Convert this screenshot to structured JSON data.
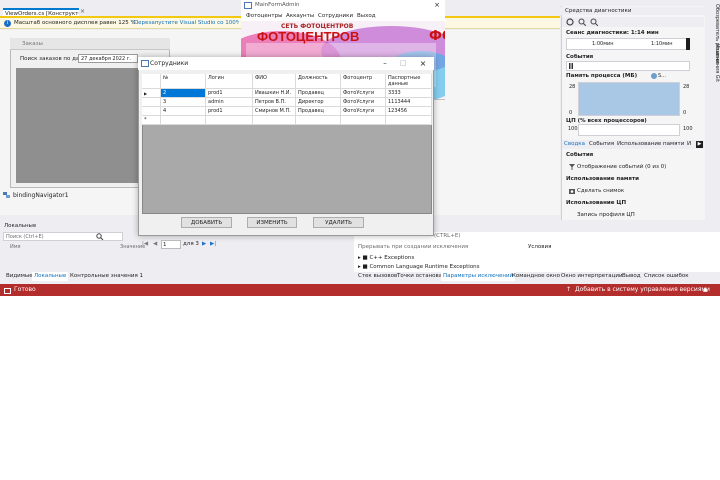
{
  "doc_tab": {
    "label": "ViewOrders.cs [Конструктор]",
    "close": "×"
  },
  "infobar": {
    "icon": "i",
    "text": "Масштаб основного дисплея равен 125 %.",
    "link": "Перезапустите Visual Studio со 100%-ным"
  },
  "designer": {
    "form_title": "Заказы",
    "search_label": "Поиск заказов по дате:",
    "date_value": "27 декабря 2022 г.",
    "binding_navigator": "bindingNavigator1"
  },
  "locals": {
    "header": "Локальные",
    "search_placeholder": "Поиск (Ctrl+E)",
    "col_name": "Имя",
    "col_value": "Значение"
  },
  "bottom_tabs_left": [
    "Видимые",
    "Локальные",
    "Контрольные значения 1"
  ],
  "exceptions": {
    "search_hint": "(CTRL+E)",
    "col_exceptions": "Прерывать при создании исключения",
    "col_conditions": "Условия",
    "rows": [
      "C++ Exceptions",
      "Common Language Runtime Exceptions"
    ]
  },
  "bottom_tabs_right": [
    "Стек вызовов",
    "Точки останова",
    "Параметры исключений",
    "Командное окно",
    "Окно интерпретации",
    "Вывод",
    "Список ошибок"
  ],
  "status": {
    "left": "Готово",
    "right": "Добавить в систему управления версиями"
  },
  "diagnostics": {
    "title": "Средства диагностики",
    "session": "Сеанс диагностики: 1:14 мин",
    "tick1": "1:00мин",
    "tick2": "1:10мин",
    "events": "События",
    "memory": "Память процесса (МБ)",
    "memory_legend": "S...",
    "mem_max_left": "28",
    "mem_max_right": "28",
    "mem_min_left": "0",
    "mem_min_right": "0",
    "cpu": "ЦП (% всех процессоров)",
    "cpu_max_left": "100",
    "cpu_max_right": "100",
    "tabs": [
      "Сводка",
      "События",
      "Использование памяти",
      "И"
    ],
    "sec_events": "События",
    "show_events": "Отображение событий (0 из 0)",
    "sec_memory": "Использование памяти",
    "snapshot": "Сделать снимок",
    "sec_cpu": "Использование ЦП",
    "cpu_profile": "Запись профиля ЦП"
  },
  "side_strip": [
    "Обозреватель решений",
    "Изменения Git"
  ],
  "main_form": {
    "title": "MainFormAdmin",
    "menu": [
      "Фотоцентры",
      "Аккаунты",
      "Сотрудники",
      "Выход"
    ],
    "banner_text": "ФОТОЦЕНТРОВ",
    "banner_sub": "СЕТЬ ФОТОЦЕНТРОВ",
    "banner_small": "ФО"
  },
  "employees": {
    "title": "Сотрудники",
    "columns": [
      "№",
      "Логин",
      "ФИО",
      "Должность",
      "Фотоцентр",
      "Паспортные данные"
    ],
    "rows": [
      [
        "2",
        "prod1",
        "Ивашкин Н.И.",
        "Продавец",
        "ФотоУслуги",
        "3333"
      ],
      [
        "3",
        "admin",
        "Петров В.П.",
        "Директор",
        "ФотоУслуги",
        "1113444"
      ],
      [
        "4",
        "prod1",
        "Смирнов М.П.",
        "Продавец",
        "ФотоУслуги",
        "123456"
      ]
    ],
    "buttons": {
      "add": "ДОБАВИТЬ",
      "edit": "ИЗМЕНИТЬ",
      "delete": "УДАЛИТЬ"
    },
    "pager_position": "1",
    "pager_total": "для 3"
  }
}
